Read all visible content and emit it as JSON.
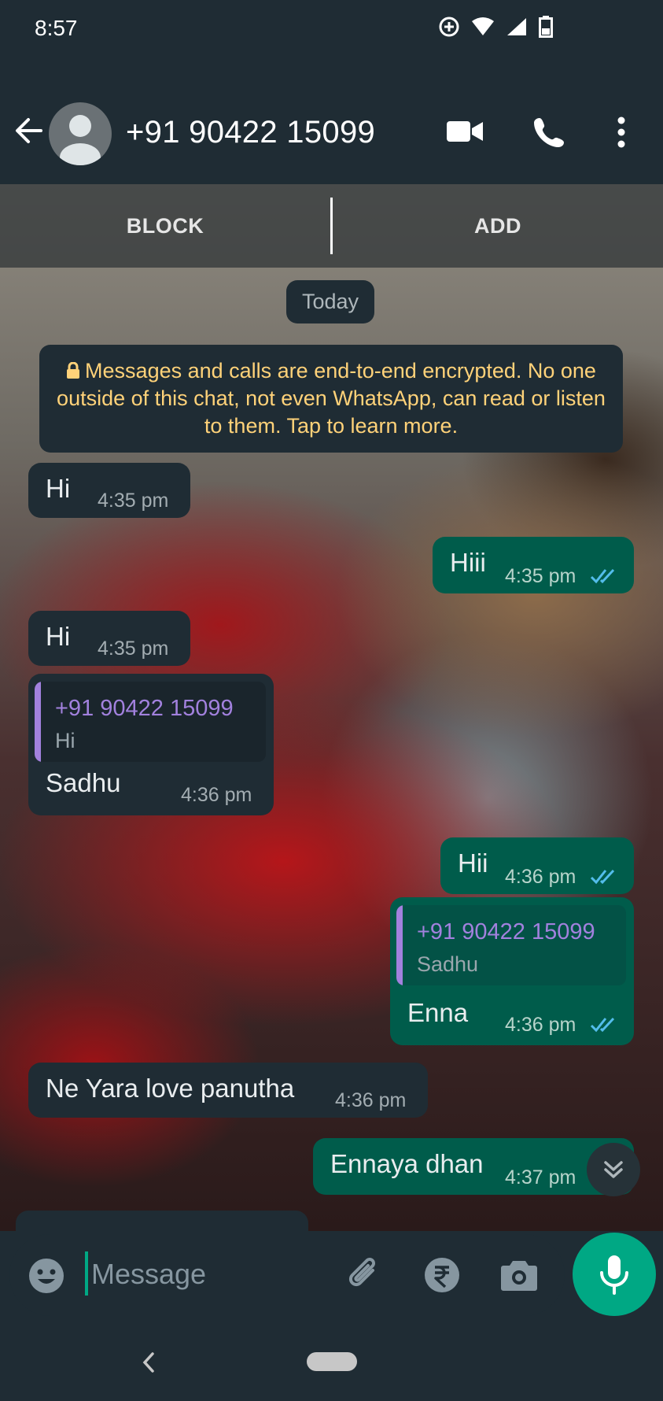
{
  "status_bar": {
    "time": "8:57",
    "icons": [
      "data-saver-icon",
      "wifi-icon",
      "signal-icon",
      "battery-icon"
    ]
  },
  "header": {
    "contact": "+91 90422 15099",
    "icons": [
      "back-arrow-icon",
      "avatar-icon",
      "video-call-icon",
      "voice-call-icon",
      "more-vert-icon"
    ]
  },
  "actions": {
    "block": "BLOCK",
    "add": "ADD"
  },
  "chat": {
    "date_label": "Today",
    "encryption_notice": "Messages and calls are end-to-end encrypted. No one outside of this chat, not even WhatsApp, can read or listen to them. Tap to learn more.",
    "messages": [
      {
        "dir": "in",
        "text": "Hi",
        "time": "4:35 pm"
      },
      {
        "dir": "out",
        "text": "Hiii",
        "time": "4:35 pm",
        "status": "read"
      },
      {
        "dir": "in",
        "text": "Hi",
        "time": "4:35 pm"
      },
      {
        "dir": "in",
        "quote_name": "+91 90422 15099",
        "quote_text": "Hi",
        "text": "Sadhu",
        "time": "4:36 pm"
      },
      {
        "dir": "out",
        "text": "Hii",
        "time": "4:36 pm",
        "status": "read"
      },
      {
        "dir": "out",
        "quote_name": "+91 90422 15099",
        "quote_text": "Sadhu",
        "text": "Enna",
        "time": "4:36 pm",
        "status": "read"
      },
      {
        "dir": "in",
        "text": "Ne Yara love panutha",
        "time": "4:36 pm"
      },
      {
        "dir": "out",
        "text": "Ennaya dhan",
        "time": "4:37 pm",
        "status": "read"
      }
    ]
  },
  "composer": {
    "placeholder": "Message",
    "icons": [
      "emoji-icon",
      "attach-icon",
      "rupee-icon",
      "camera-icon",
      "mic-icon"
    ]
  },
  "colors": {
    "bar_bg": "#1f2c34",
    "incoming_bubble": "#1f2c34",
    "outgoing_bubble": "#005c4b",
    "accent": "#00a884",
    "read_ticks": "#53bdeb",
    "quote_accent": "#a281de",
    "notice_text": "#ffd279"
  }
}
